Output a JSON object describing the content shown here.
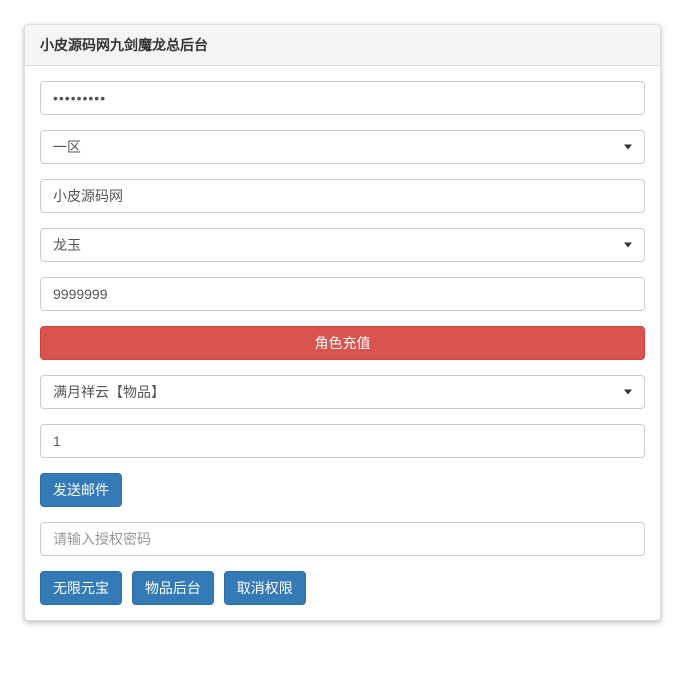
{
  "panel": {
    "title": "小皮源码网九剑魔龙总后台"
  },
  "form": {
    "password_value": "123456789",
    "zone": {
      "selected": "一区"
    },
    "account_value": "小皮源码网",
    "char": {
      "selected": "龙玉"
    },
    "amount_value": "9999999",
    "recharge_button": "角色充值",
    "item": {
      "selected": "满月祥云【物品】"
    },
    "count_value": "1",
    "send_mail_button": "发送邮件",
    "auth_password_placeholder": "请输入授权密码",
    "actions": {
      "unlimited_gold": "无限元宝",
      "item_backend": "物品后台",
      "revoke_permission": "取消权限"
    }
  }
}
